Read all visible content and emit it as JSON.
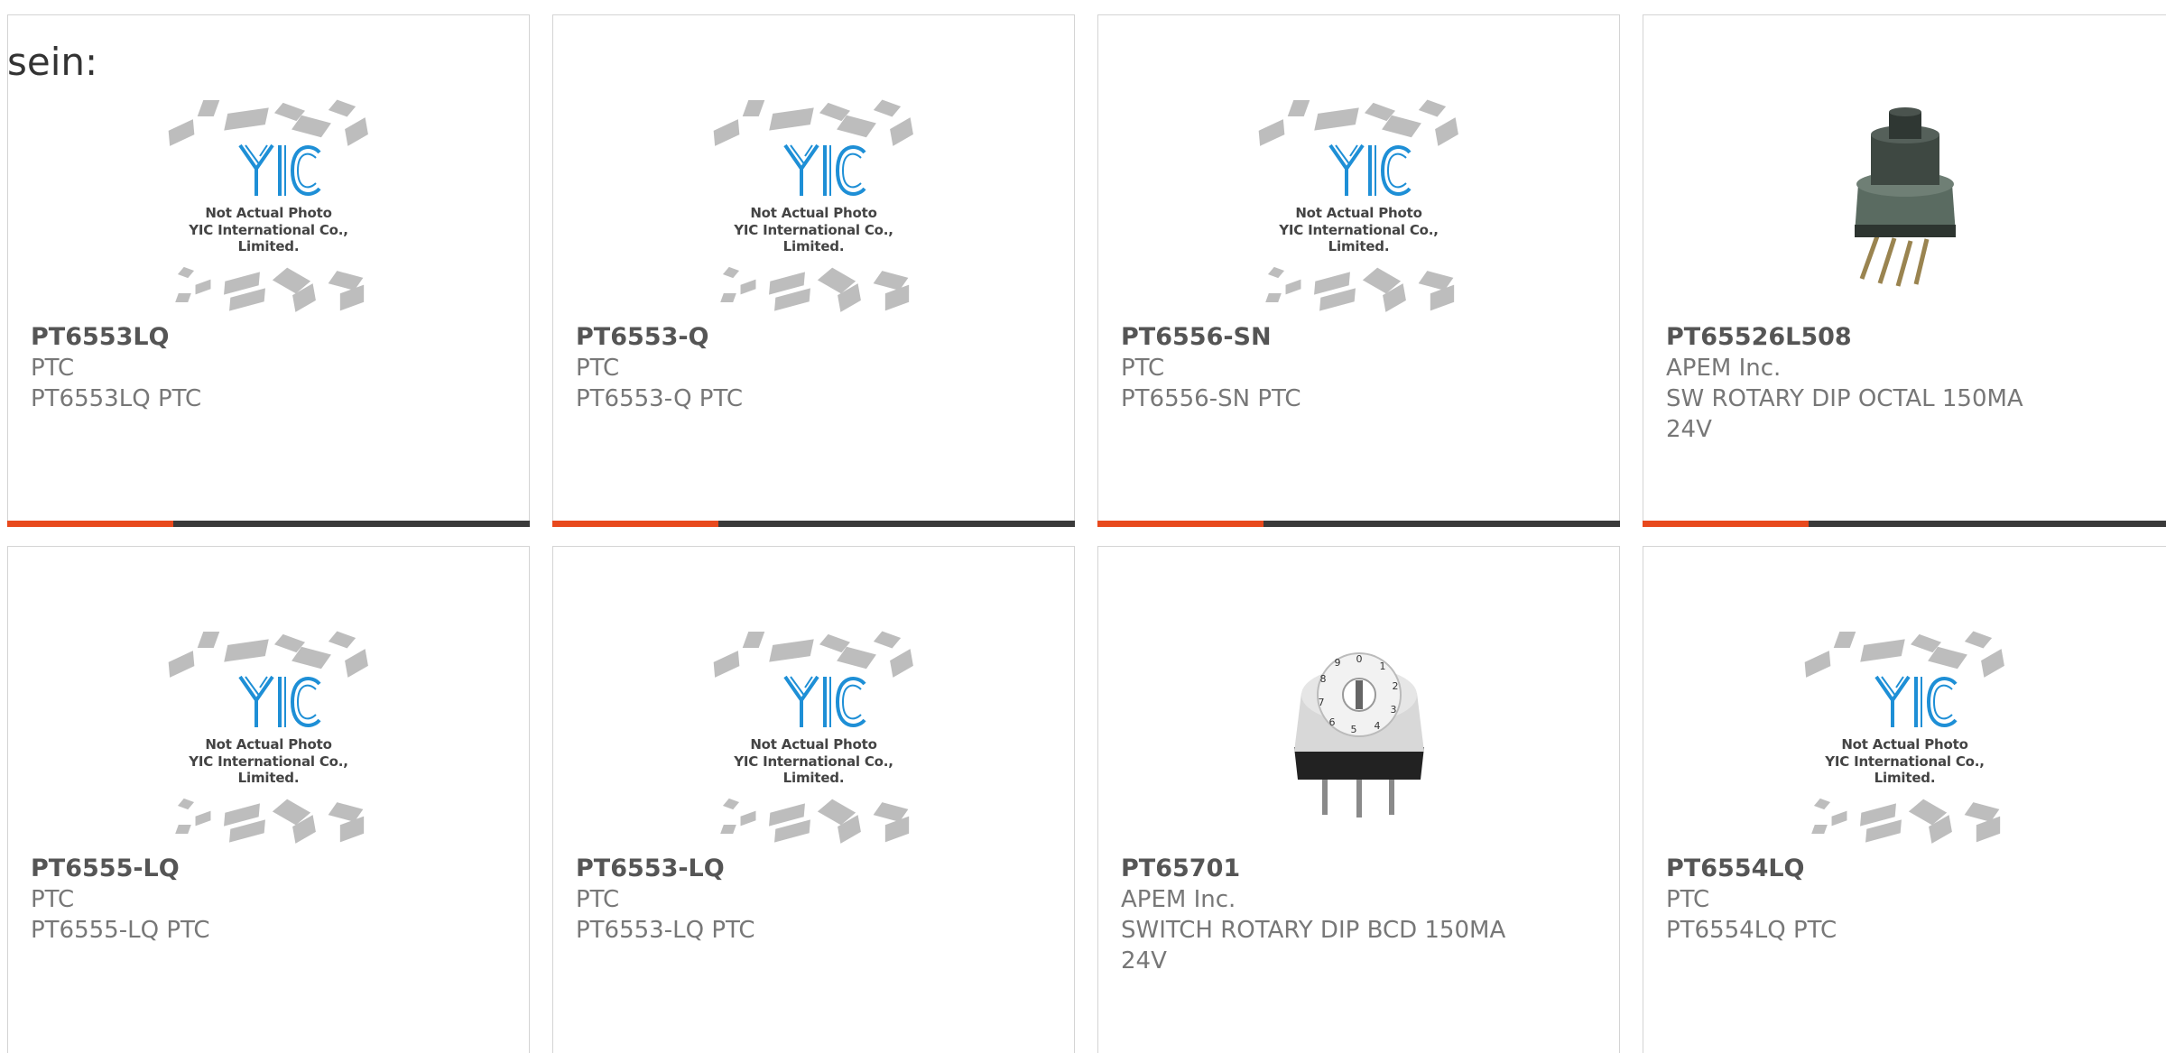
{
  "intro_text": "sein:",
  "placeholder": {
    "line1": "Not Actual Photo",
    "line2": "YIC International Co., Limited.",
    "logo_text": "YIC"
  },
  "colors": {
    "accent": "#e8491d",
    "bar": "#3a3a3a",
    "logo_blue": "#1e8fd6"
  },
  "products": [
    {
      "part": "PT6553LQ",
      "manufacturer": "PTC",
      "description": "PT6553LQ PTC",
      "image": "placeholder"
    },
    {
      "part": "PT6553-Q",
      "manufacturer": "PTC",
      "description": "PT6553-Q PTC",
      "image": "placeholder"
    },
    {
      "part": "PT6556-SN",
      "manufacturer": "PTC",
      "description": "PT6556-SN PTC",
      "image": "placeholder"
    },
    {
      "part": "PT65526L508",
      "manufacturer": "APEM Inc.",
      "description": "SW ROTARY DIP OCTAL 150MA 24V",
      "image": "rotary-switch-photo"
    },
    {
      "part": "PT6555-LQ",
      "manufacturer": "PTC",
      "description": "PT6555-LQ PTC",
      "image": "placeholder"
    },
    {
      "part": "PT6553-LQ",
      "manufacturer": "PTC",
      "description": "PT6553-LQ PTC",
      "image": "placeholder"
    },
    {
      "part": "PT65701",
      "manufacturer": "APEM Inc.",
      "description": "SWITCH ROTARY DIP BCD 150MA 24V",
      "image": "bcd-switch-photo"
    },
    {
      "part": "PT6554LQ",
      "manufacturer": "PTC",
      "description": "PT6554LQ PTC",
      "image": "placeholder"
    }
  ]
}
